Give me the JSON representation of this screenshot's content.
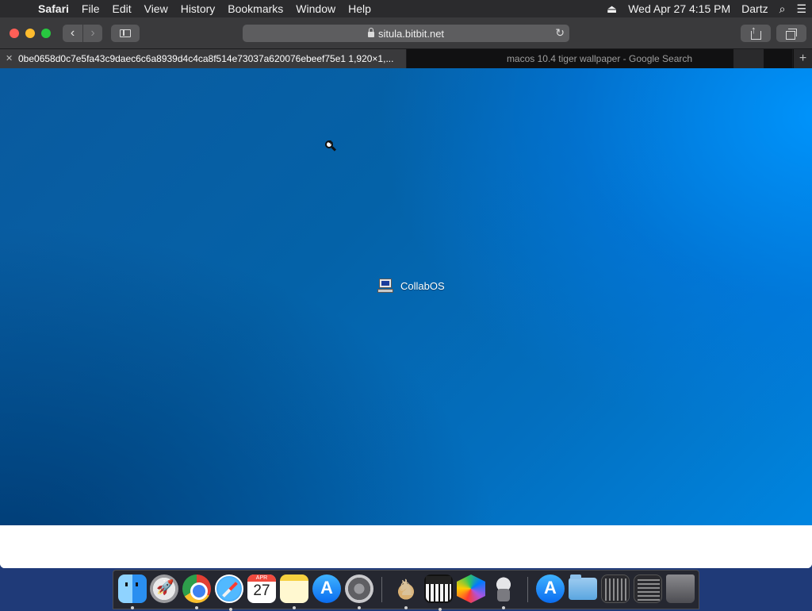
{
  "menubar": {
    "apple_icon": "apple-logo-icon",
    "app": "Safari",
    "menus": [
      "File",
      "Edit",
      "View",
      "History",
      "Bookmarks",
      "Window",
      "Help"
    ],
    "datetime": "Wed Apr 27  4:15 PM",
    "user": "Dartz"
  },
  "toolbar": {
    "url": "situla.bitbit.net"
  },
  "tabs": {
    "active": "0be0658d0c7e5fa43c9daec6c6a8939d4c4ca8f514e73037a620076ebeef75e1 1,920×1,...",
    "inactive": "macos 10.4 tiger wallpaper - Google Search",
    "new_tab": "+"
  },
  "content": {
    "desktop_icon_label": "CollabOS",
    "accent": "#0078d4"
  },
  "dock": {
    "calendar_day": "27",
    "apps": [
      "Finder",
      "Launchpad",
      "Google Chrome",
      "Safari",
      "Calendar",
      "Notes",
      "App Store",
      "System Preferences",
      "Chess",
      "Piano",
      "Grapher",
      "Automator",
      "App Store",
      "Folder",
      "Stack",
      "Stack",
      "Trash"
    ]
  }
}
